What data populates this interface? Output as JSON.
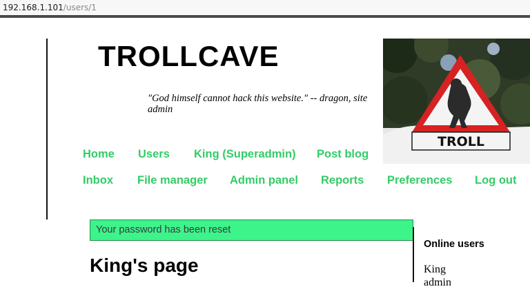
{
  "browser": {
    "url_host": "192.168.1.101",
    "url_path": "/users/1"
  },
  "site": {
    "title": "TROLLCAVE",
    "tagline": "\"God himself cannot hack this website.\" -- dragon, site admin",
    "sign_text": "TROLL"
  },
  "nav": {
    "home": "Home",
    "users": "Users",
    "king": "King (Superadmin)",
    "post_blog": "Post blog",
    "inbox": "Inbox",
    "file_manager": "File manager",
    "admin_panel": "Admin panel",
    "reports": "Reports",
    "preferences": "Preferences",
    "log_out": "Log out"
  },
  "flash": {
    "message": "Your password has been reset"
  },
  "main": {
    "heading": "King's page"
  },
  "sidebar": {
    "online_title": "Online users",
    "users": [
      "King",
      "admin"
    ]
  },
  "colors": {
    "nav_link": "#33cc66",
    "flash_bg": "#3cf48a",
    "sign_red": "#d62222"
  }
}
